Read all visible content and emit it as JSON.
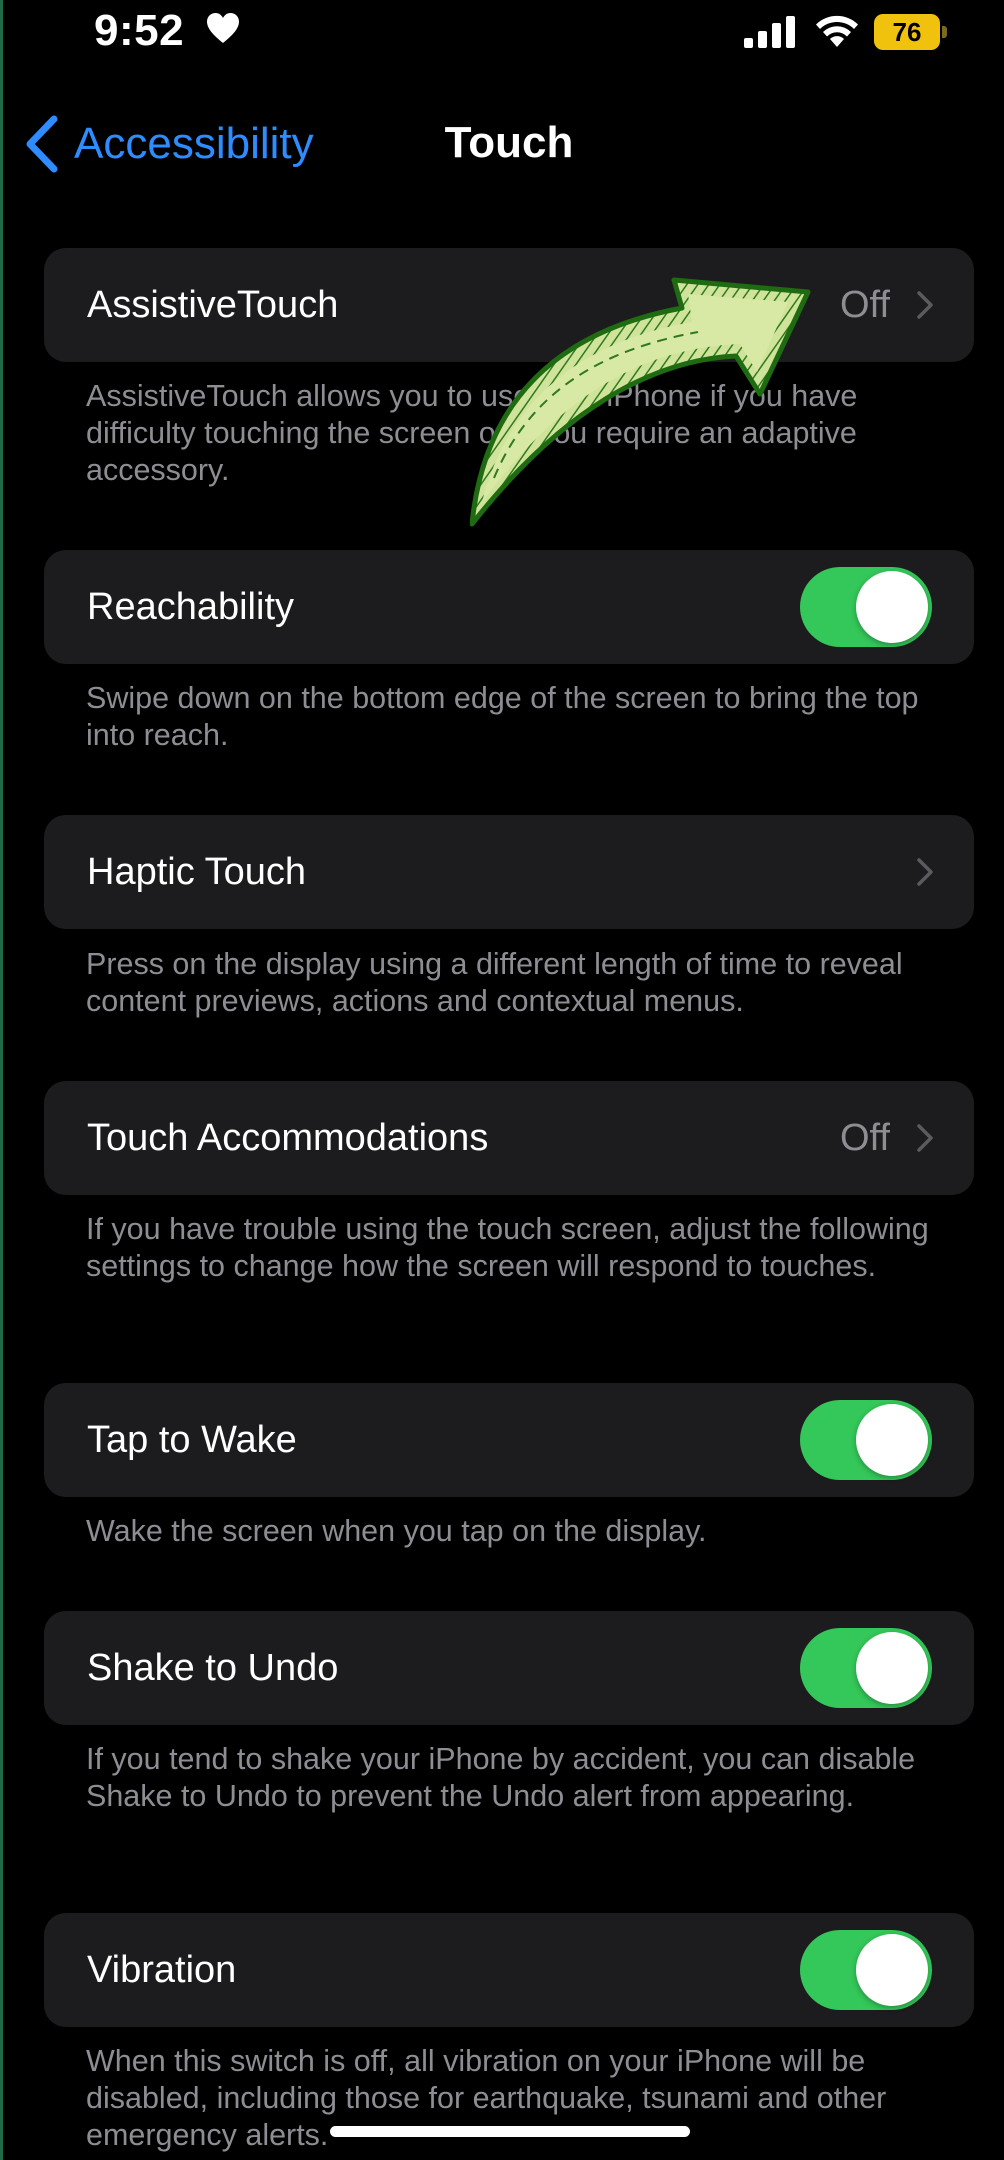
{
  "status_bar": {
    "time": "9:52",
    "battery": "76"
  },
  "nav": {
    "back_label": "Accessibility",
    "title": "Touch"
  },
  "rows": [
    {
      "label": "AssistiveTouch",
      "value": "Off",
      "control": "chevron",
      "footer": "AssistiveTouch allows you to use your iPhone if you have difficulty touching the screen or if you require an adaptive accessory."
    },
    {
      "label": "Reachability",
      "control": "toggle",
      "on": true,
      "footer": "Swipe down on the bottom edge of the screen to bring the top into reach."
    },
    {
      "label": "Haptic Touch",
      "control": "chevron",
      "footer": "Press on the display using a different length of time to reveal content previews, actions and contextual menus."
    },
    {
      "label": "Touch Accommodations",
      "value": "Off",
      "control": "chevron",
      "footer": "If you have trouble using the touch screen, adjust the following settings to change how the screen will respond to touches."
    },
    {
      "label": "Tap to Wake",
      "control": "toggle",
      "on": true,
      "footer": "Wake the screen when you tap on the display."
    },
    {
      "label": "Shake to Undo",
      "control": "toggle",
      "on": true,
      "footer": "If you tend to shake your iPhone by accident, you can disable Shake to Undo to prevent the Undo alert from appearing."
    },
    {
      "label": "Vibration",
      "control": "toggle",
      "on": true,
      "footer": "When this switch is off, all vibration on your iPhone will be disabled, including those for earthquake, tsunami and other emergency alerts."
    }
  ],
  "colors": {
    "accent": "#2f8cff",
    "toggle_on": "#34c759",
    "cell": "#1c1c1e",
    "secondary_text": "#8d8d93",
    "annotation_arrow": "#cfe39a"
  },
  "icons": [
    "heart-icon",
    "cellular-signal-icon",
    "wifi-icon",
    "battery-icon",
    "chevron-left-icon",
    "chevron-right-icon",
    "annotation-arrow-icon"
  ]
}
